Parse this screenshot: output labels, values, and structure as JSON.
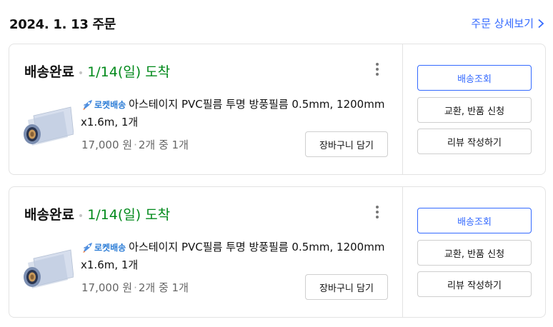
{
  "order": {
    "date": "2024. 1. 13 주문",
    "detail_link": "주문 상세보기"
  },
  "colors": {
    "accent": "#346aff",
    "arrival_green": "#00891a",
    "rocket_blue": "#2b7cd6",
    "border": "#e3e3e3"
  },
  "cards": [
    {
      "status": "배송완료",
      "dot": "•",
      "arrival": "1/14(일) 도착",
      "rocket_label": "로켓배송",
      "title": "아스테이지 PVC필름 투명 방풍필름 0.5mm, 1200mm x1.6m, 1개",
      "price": "17,000 원",
      "dot_sep": "·",
      "quantity": "2개 중 1개",
      "cart_button": "장바구니 담기",
      "actions": {
        "track": "배송조회",
        "exchange": "교환, 반품 신청",
        "review": "리뷰 작성하기"
      }
    },
    {
      "status": "배송완료",
      "dot": "•",
      "arrival": "1/14(일) 도착",
      "rocket_label": "로켓배송",
      "title": "아스테이지 PVC필름 투명 방풍필름 0.5mm, 1200mm x1.6m, 1개",
      "price": "17,000 원",
      "dot_sep": "·",
      "quantity": "2개 중 1개",
      "cart_button": "장바구니 담기",
      "actions": {
        "track": "배송조회",
        "exchange": "교환, 반품 신청",
        "review": "리뷰 작성하기"
      }
    }
  ]
}
